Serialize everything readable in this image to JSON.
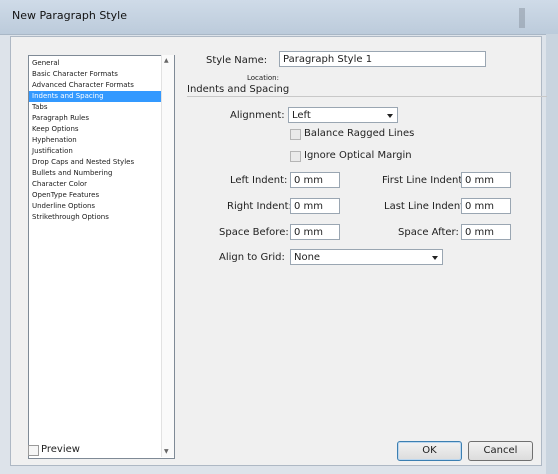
{
  "window": {
    "title": "New Paragraph Style"
  },
  "categories": {
    "items": [
      "General",
      "Basic Character Formats",
      "Advanced Character Formats",
      "Indents and Spacing",
      "Tabs",
      "Paragraph Rules",
      "Keep Options",
      "Hyphenation",
      "Justification",
      "Drop Caps and Nested Styles",
      "Bullets and Numbering",
      "Character Color",
      "OpenType Features",
      "Underline Options",
      "Strikethrough Options"
    ],
    "selected": "Indents and Spacing"
  },
  "style_name": {
    "label": "Style Name:",
    "value": "Paragraph Style 1"
  },
  "location_label": "Location:",
  "section_title": "Indents and Spacing",
  "alignment": {
    "label": "Alignment:",
    "value": "Left"
  },
  "balance_ragged": {
    "label": "Balance Ragged Lines",
    "checked": false
  },
  "ignore_optical": {
    "label": "Ignore Optical Margin",
    "checked": false
  },
  "left_indent": {
    "label": "Left Indent:",
    "value": "0 mm"
  },
  "first_line_indent": {
    "label": "First Line Indent:",
    "value": "0 mm"
  },
  "right_indent": {
    "label": "Right Indent:",
    "value": "0 mm"
  },
  "last_line_indent": {
    "label": "Last Line Indent:",
    "value": "0 mm"
  },
  "space_before": {
    "label": "Space Before:",
    "value": "0 mm"
  },
  "space_after": {
    "label": "Space After:",
    "value": "0 mm"
  },
  "align_to_grid": {
    "label": "Align to Grid:",
    "value": "None"
  },
  "preview": {
    "label": "Preview",
    "checked": false
  },
  "buttons": {
    "ok": "OK",
    "cancel": "Cancel"
  }
}
